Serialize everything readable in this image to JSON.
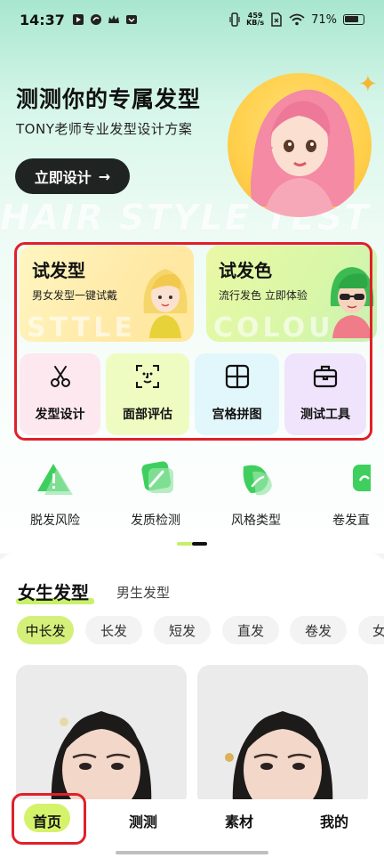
{
  "status_bar": {
    "time": "14:37",
    "speed_value": "459",
    "speed_unit": "KB/s",
    "battery": "71%"
  },
  "hero": {
    "title": "测测你的专属发型",
    "subtitle": "TONY老师专业发型设计方案",
    "cta_label": "立即设计",
    "cta_arrow": "→",
    "background_text": "HAIR STYLE TEST"
  },
  "feature_cards": [
    {
      "title": "试发型",
      "subtitle": "男女发型一键试戴",
      "watermark": "STTLE"
    },
    {
      "title": "试发色",
      "subtitle": "流行发色 立即体验",
      "watermark": "COLOU"
    }
  ],
  "mini_cards": [
    {
      "label": "发型设计",
      "icon": "scissors-icon"
    },
    {
      "label": "面部评估",
      "icon": "face-scan-icon"
    },
    {
      "label": "宫格拼图",
      "icon": "grid-icon"
    },
    {
      "label": "测试工具",
      "icon": "toolbox-icon"
    }
  ],
  "tools": [
    {
      "label": "脱发风险",
      "icon": "warning-icon"
    },
    {
      "label": "发质检测",
      "icon": "brush-icon"
    },
    {
      "label": "风格类型",
      "icon": "leaf-icon"
    },
    {
      "label": "卷发直",
      "icon": "curl-icon"
    }
  ],
  "section": {
    "tab_active": "女生发型",
    "tab_other": "男生发型"
  },
  "chips": [
    "中长发",
    "长发",
    "短发",
    "直发",
    "卷发",
    "女"
  ],
  "nav": {
    "items": [
      "首页",
      "测测",
      "素材",
      "我的"
    ],
    "active": "首页"
  },
  "colors": {
    "accent": "#c9f06a",
    "dark_button": "#1f2322",
    "highlight_frame": "#e0202a"
  }
}
